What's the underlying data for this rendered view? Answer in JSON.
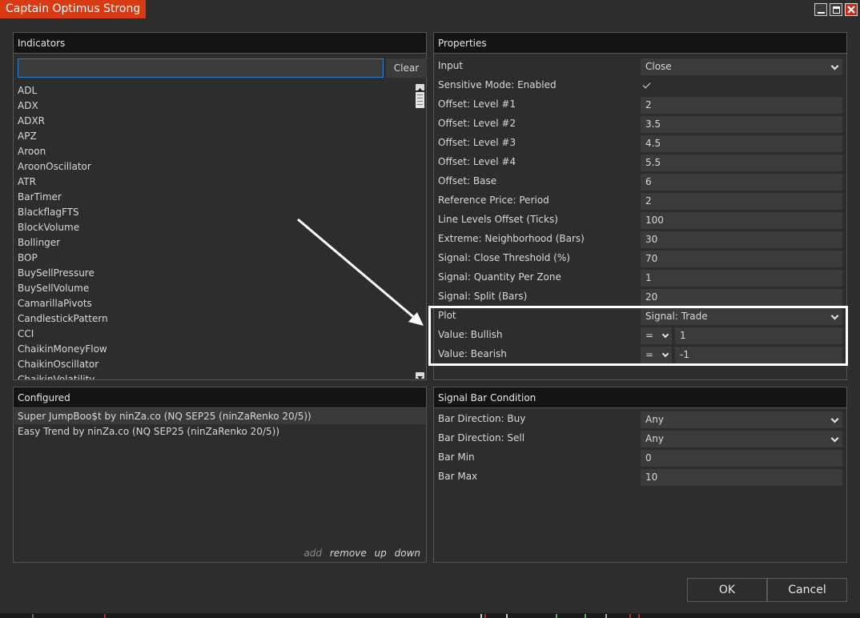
{
  "window": {
    "title": "Captain Optimus Strong",
    "accent": "#d83a14"
  },
  "indicators": {
    "header": "Indicators",
    "search": {
      "value": "",
      "placeholder": ""
    },
    "clear_label": "Clear",
    "items": [
      "ADL",
      "ADX",
      "ADXR",
      "APZ",
      "Aroon",
      "AroonOscillator",
      "ATR",
      "BarTimer",
      "BlackflagFTS",
      "BlockVolume",
      "Bollinger",
      "BOP",
      "BuySellPressure",
      "BuySellVolume",
      "CamarillaPivots",
      "CandlestickPattern",
      "CCI",
      "ChaikinMoneyFlow",
      "ChaikinOscillator",
      "ChaikinVolatility"
    ]
  },
  "configured": {
    "header": "Configured",
    "items": [
      "Super JumpBoo$t by ninZa.co (NQ SEP25 (ninZaRenko 20/5))",
      "Easy Trend by ninZa.co (NQ SEP25 (ninZaRenko 20/5))"
    ],
    "actions": {
      "add": "add",
      "remove": "remove",
      "up": "up",
      "down": "down"
    }
  },
  "properties": {
    "header": "Properties",
    "rows": [
      {
        "label": "Input",
        "value": "Close",
        "kind": "select"
      },
      {
        "label": "Sensitive Mode: Enabled",
        "value": "",
        "kind": "checkbox",
        "checked": true
      },
      {
        "label": "Offset: Level #1",
        "value": "2",
        "kind": "text"
      },
      {
        "label": "Offset: Level #2",
        "value": "3.5",
        "kind": "text"
      },
      {
        "label": "Offset: Level #3",
        "value": "4.5",
        "kind": "text"
      },
      {
        "label": "Offset: Level #4",
        "value": "5.5",
        "kind": "text"
      },
      {
        "label": "Offset: Base",
        "value": "6",
        "kind": "text"
      },
      {
        "label": "Reference Price: Period",
        "value": "2",
        "kind": "text"
      },
      {
        "label": "Line Levels Offset (Ticks)",
        "value": "100",
        "kind": "text"
      },
      {
        "label": "Extreme: Neighborhood (Bars)",
        "value": "30",
        "kind": "text"
      },
      {
        "label": "Signal: Close Threshold (%)",
        "value": "70",
        "kind": "text"
      },
      {
        "label": "Signal: Quantity Per Zone",
        "value": "1",
        "kind": "text"
      },
      {
        "label": "Signal: Split (Bars)",
        "value": "20",
        "kind": "text"
      },
      {
        "label": "Plot",
        "value": "Signal: Trade",
        "kind": "select"
      },
      {
        "label": "Value: Bullish",
        "op": "=",
        "value": "1",
        "kind": "op"
      },
      {
        "label": "Value: Bearish",
        "op": "=",
        "value": "-1",
        "kind": "op"
      }
    ]
  },
  "signal_bar": {
    "header": "Signal Bar Condition",
    "rows": [
      {
        "label": "Bar Direction: Buy",
        "value": "Any",
        "kind": "select"
      },
      {
        "label": "Bar Direction: Sell",
        "value": "Any",
        "kind": "select"
      },
      {
        "label": "Bar Min",
        "value": "0",
        "kind": "text"
      },
      {
        "label": "Bar Max",
        "value": "10",
        "kind": "text"
      }
    ]
  },
  "buttons": {
    "ok": "OK",
    "cancel": "Cancel"
  }
}
